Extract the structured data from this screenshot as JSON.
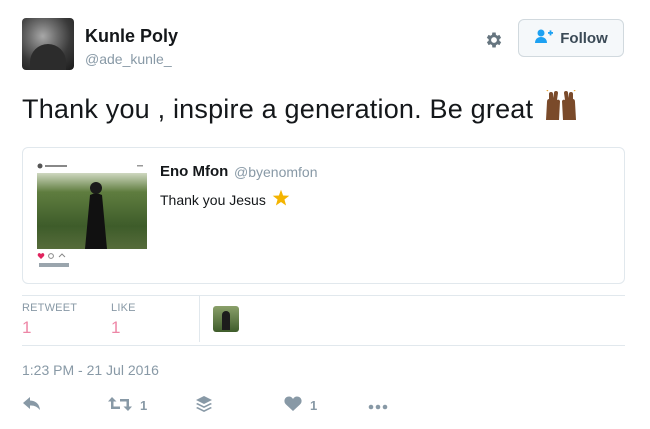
{
  "author": {
    "name": "Kunle Poly",
    "handle": "@ade_kunle_"
  },
  "follow_button": {
    "label": "Follow",
    "icon": "person-add-icon"
  },
  "settings": {
    "icon": "gear-icon"
  },
  "tweet": {
    "text": "Thank you , inspire a generation. Be great",
    "emoji": "raised-hands-icon"
  },
  "quoted_tweet": {
    "name": "Eno Mfon",
    "handle": "@byenomfon",
    "text": "Thank you Jesus",
    "emoji": "star-icon"
  },
  "stats": {
    "retweet_label": "RETWEET",
    "retweet_count": "1",
    "like_label": "LIKE",
    "like_count": "1"
  },
  "timestamp": "1:23 PM - 21 Jul 2016",
  "actions": {
    "retweet_count": "1",
    "like_count": "1"
  },
  "colors": {
    "muted": "#8899a6",
    "border": "#e1e8ed",
    "like": "#e0245e",
    "star": "#f4b400"
  }
}
